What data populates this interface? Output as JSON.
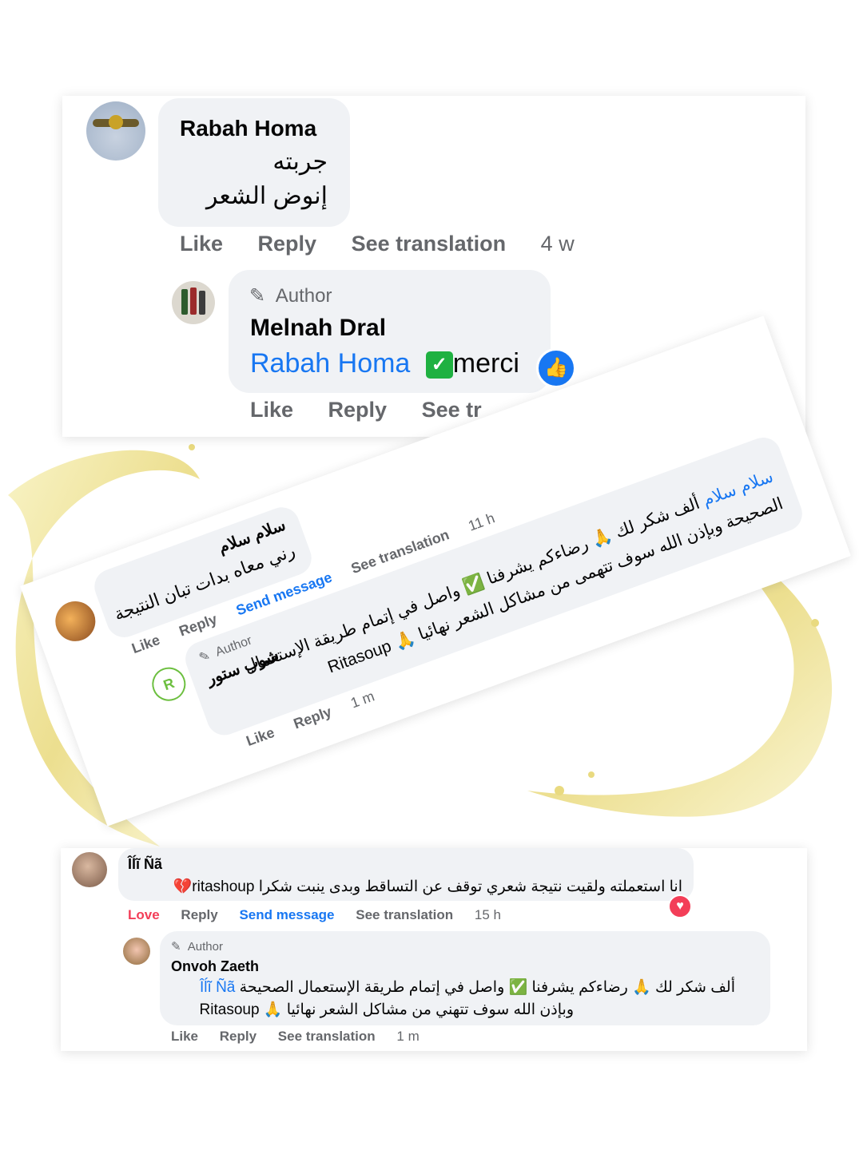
{
  "card1": {
    "comment": {
      "author": "Rabah Homa",
      "line1": "جربته",
      "line2": "إنوض الشعر",
      "actions": {
        "like": "Like",
        "reply": "Reply",
        "translate": "See translation",
        "time": "4 w"
      }
    },
    "reply": {
      "badge": "Author",
      "author": "Melnah Dral",
      "mention": "Rabah Homa",
      "text": "merci",
      "actions": {
        "like": "Like",
        "reply": "Reply",
        "translate": "See tr"
      }
    }
  },
  "card2": {
    "comment": {
      "author": "سلام سلام",
      "text": "رني معاه بدات تبان النتيجة",
      "actions": {
        "like": "Like",
        "reply": "Reply",
        "send": "Send message",
        "translate": "See translation",
        "time": "11 h"
      }
    },
    "reply": {
      "badge": "Author",
      "author": "شوب ستور",
      "mention": "سلام سلام",
      "line1": "ألف شكر لك 🙏 رضاءكم يشرفنا ✅ واصل في إتمام طريقة الإستعمال",
      "line2": "الصحيحة وبإذن الله سوف تتهمى من مشاكل الشعر نهائيا 🙏 Ritasoup",
      "actions": {
        "like": "Like",
        "reply": "Reply",
        "time": "1 m"
      }
    }
  },
  "card3": {
    "comment": {
      "author": "Îĺĩ Ñã",
      "text": "انا استعملته ولقيت نتيجة شعري توقف عن التساقط وبدى ينبت شكرا ritashoup",
      "actions": {
        "love": "Love",
        "reply": "Reply",
        "send": "Send message",
        "translate": "See translation",
        "time": "15 h"
      }
    },
    "reply": {
      "badge": "Author",
      "author": "Onvoh Zaeth",
      "mention": "Îĺĩ Ñã",
      "line1": "ألف شكر لك 🙏 رضاءكم يشرفنا ✅ واصل في إتمام طريقة الإستعمال الصحيحة",
      "line2": "وبإذن الله سوف تتهني من مشاكل الشعر نهائيا 🙏 Ritasoup",
      "actions": {
        "like": "Like",
        "reply": "Reply",
        "translate": "See translation",
        "time": "1 m"
      }
    }
  },
  "colors": {
    "link": "#1877f2",
    "love": "#f33e58",
    "check": "#1fb141",
    "splash": "#efe28a"
  }
}
